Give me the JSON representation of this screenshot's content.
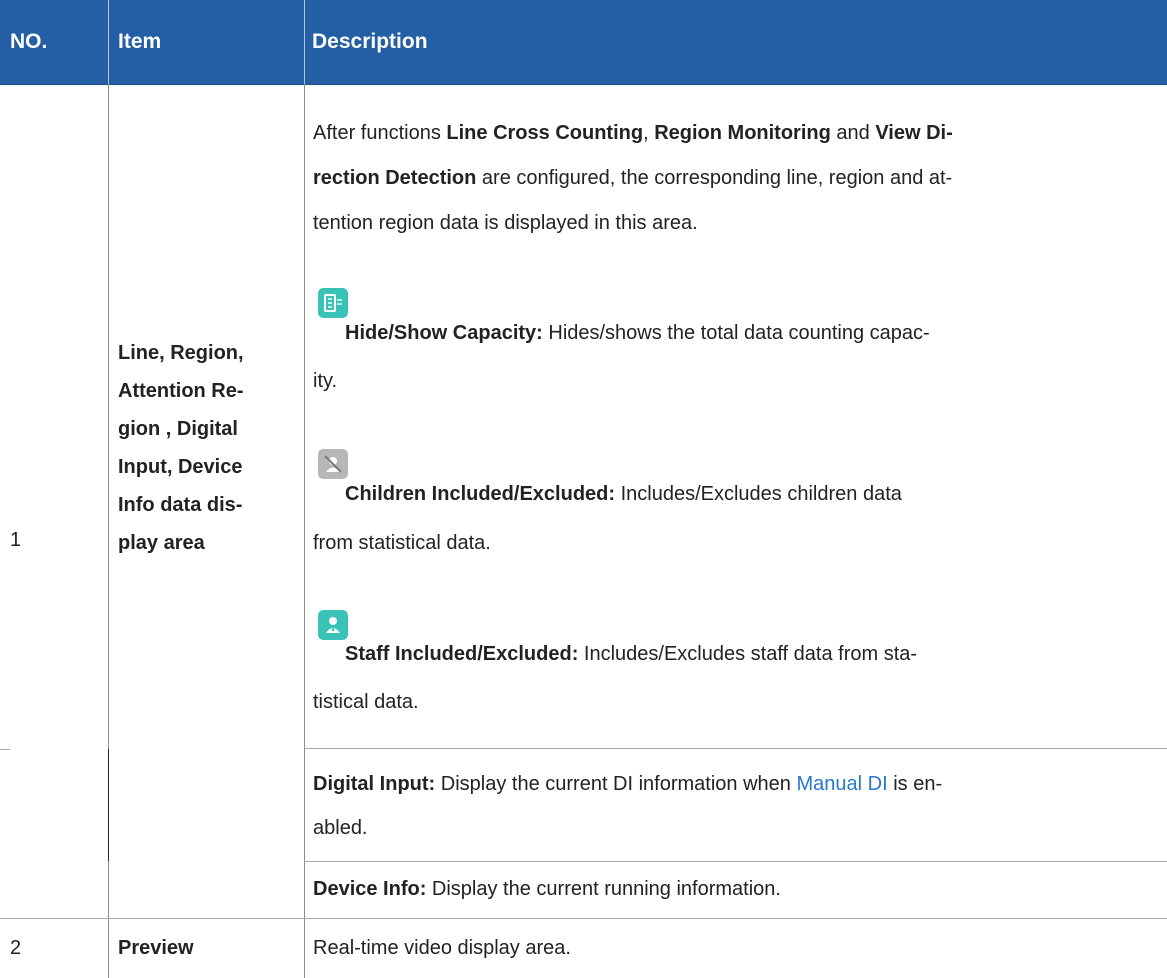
{
  "colors": {
    "header_bg": "#245fa6",
    "header_text": "#ffffff",
    "link": "#2a78c9",
    "icon_teal": "#38c3b6",
    "icon_gray": "#b7b7b7"
  },
  "header": {
    "no": "NO.",
    "item": "Item",
    "description": "Description"
  },
  "rows": [
    {
      "no": "1",
      "item_lines": [
        "Line, Region,",
        "Attention Re-",
        "gion , Digital",
        "Input, Device",
        "Info data dis-",
        "play area"
      ],
      "intro": {
        "line1_prefix": "After functions ",
        "line1_bold1": "Line Cross Counting",
        "line1_sep": ", ",
        "line1_bold2": "Region Monitoring",
        "line1_and": " and ",
        "line1_bold3": "View Di-",
        "line2_bold": "rection Detection",
        "line2_suffix": "  are configured, the corresponding line, region and at-",
        "line3": "tention region data is displayed in this area."
      },
      "icon_items": [
        {
          "icon": "capacity-icon",
          "bold": "Hide/Show Capacity:",
          "text": " Hides/shows the total data counting capac-",
          "text_cont": "ity."
        },
        {
          "icon": "children-icon",
          "bold": "Children Included/Excluded:",
          "text": " Includes/Excludes children data",
          "text_cont": "from statistical data."
        },
        {
          "icon": "staff-icon",
          "bold": "Staff Included/Excluded:",
          "text": " Includes/Excludes staff data from sta-",
          "text_cont": "tistical data."
        }
      ],
      "digital_input": {
        "bold": "Digital Input:",
        "prefix": " Display the current DI information when ",
        "link": "Manual DI",
        "suffix": " is en-",
        "cont": "abled."
      },
      "device_info": {
        "bold": "Device Info:",
        "text": " Display the current running information."
      }
    },
    {
      "no": "2",
      "item": "Preview",
      "description": "Real-time video display area."
    }
  ]
}
